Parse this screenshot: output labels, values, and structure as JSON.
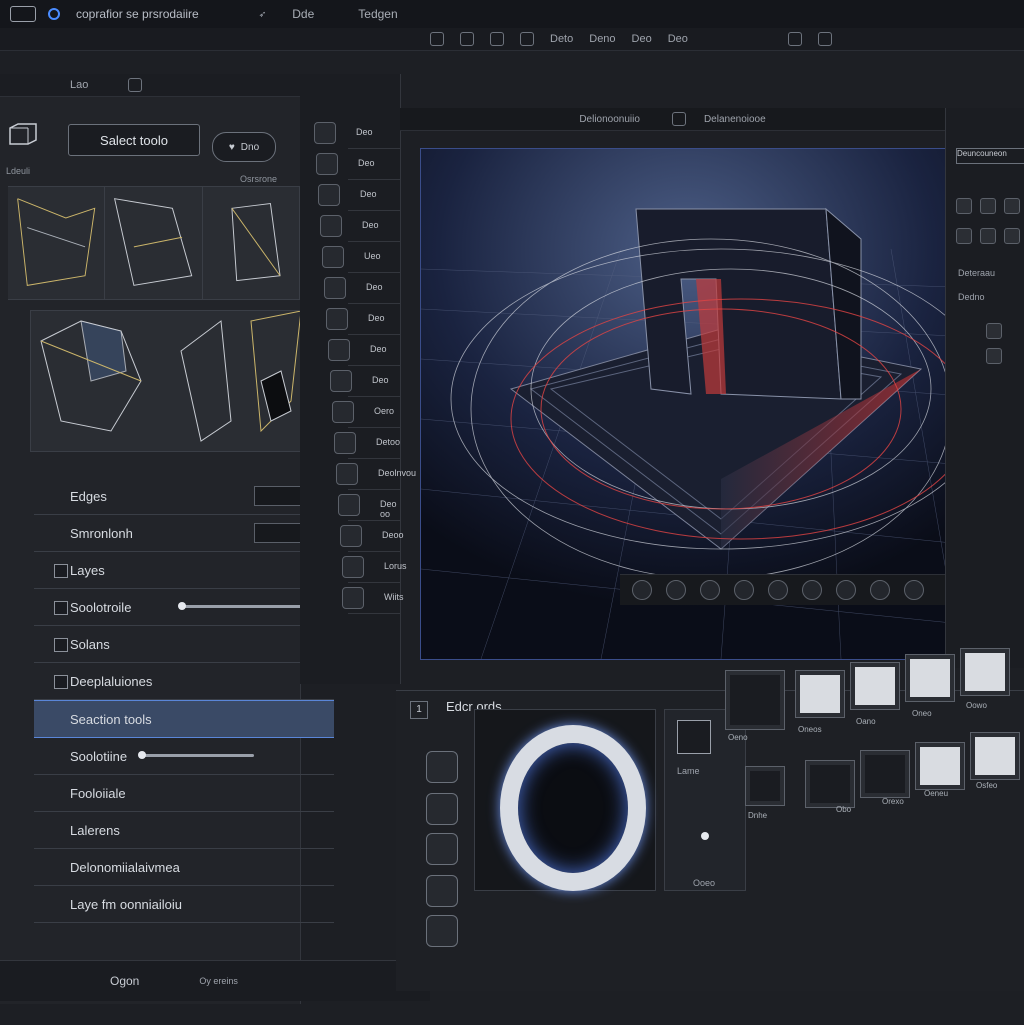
{
  "titlebar": {
    "app_title": "coprafior se prsrodaiire",
    "menu_1": "Dde",
    "menu_2": "Tedgen"
  },
  "toolstrip": {
    "item_1": "Deto",
    "item_2": "Deno",
    "item_3": "Deo",
    "item_4": "Deo"
  },
  "left_panel": {
    "tab_1": "Lao",
    "select_tools_label": "Salect toolo",
    "heart_button_label": "Dno",
    "small_label_1": "Ldeuli",
    "small_label_2": "Osrsrone",
    "rows": [
      {
        "label": "Edges"
      },
      {
        "label": "Smronlonh"
      },
      {
        "label": "Layes"
      },
      {
        "label": "Soolotroile"
      },
      {
        "label": "Solans"
      },
      {
        "label": "Deeplaluiones"
      },
      {
        "label": "Seaction tools"
      },
      {
        "label": "Soolotiine"
      },
      {
        "label": "Fooloiiale"
      },
      {
        "label": "Lalerens"
      },
      {
        "label": "Delonomiialaivmea"
      },
      {
        "label": "Laye fm oonniailoiu"
      }
    ],
    "bottom_label": "Ogon",
    "bottom_hint": "Oy ereins"
  },
  "mid_tools": {
    "labels": [
      "Deo",
      "Deo",
      "Deo",
      "Deo",
      "Ueo",
      "Deo",
      "Deo",
      "Deo",
      "Deo",
      "Oero",
      "Detoo",
      "Deolnvou",
      "Deo oo",
      "Deoo",
      "Lorus",
      "Wiits"
    ]
  },
  "viewport_header": {
    "label_1": "Delionoonuiio",
    "label_2": "Delanenoiooe"
  },
  "right_panel": {
    "header_1": "Deuncouneon",
    "label_1": "Deteraau",
    "label_2": "Dedno"
  },
  "editor": {
    "number": "1",
    "title": "Edcr ords",
    "thumb_label": "Lame",
    "knob_label": "Ooeo",
    "swatch_labels": [
      "Oeno",
      "Oneos",
      "Oano",
      "Oneo",
      "Oowo",
      "Dnhe",
      "Obo",
      "Orexo",
      "Oeneu",
      "Osfeo"
    ]
  },
  "colors": {
    "accent": "#4a8cff",
    "highlight": "#3a4a66",
    "red_glow": "#d43434"
  }
}
